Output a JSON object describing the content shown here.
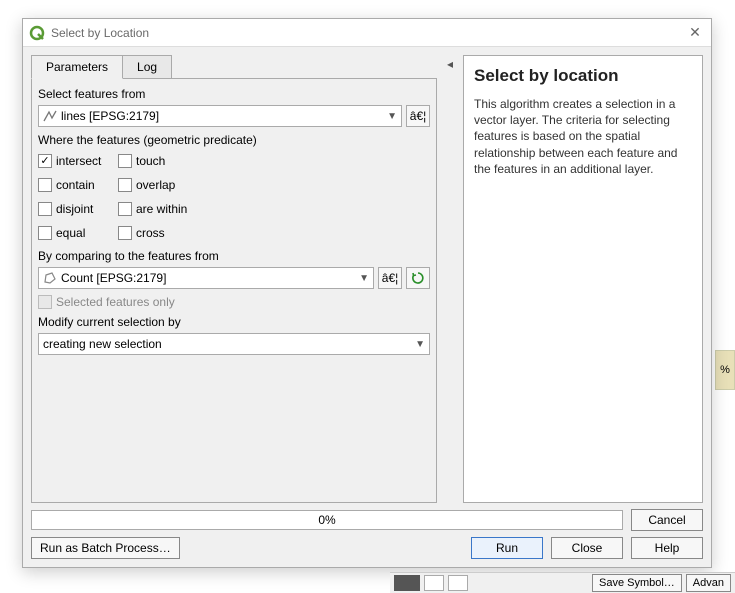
{
  "window": {
    "title": "Select by Location",
    "close_glyph": "✕"
  },
  "tabs": {
    "parameters": "Parameters",
    "log": "Log"
  },
  "form": {
    "select_from_label": "Select features from",
    "select_from_value": "lines [EPSG:2179]",
    "predicate_label": "Where the features (geometric predicate)",
    "predicates": {
      "intersect": "intersect",
      "touch": "touch",
      "contain": "contain",
      "overlap": "overlap",
      "disjoint": "disjoint",
      "are_within": "are within",
      "equal": "equal",
      "cross": "cross"
    },
    "compare_label": "By comparing to the features from",
    "compare_value": "Count [EPSG:2179]",
    "selected_only": "Selected features only",
    "modify_label": "Modify current selection by",
    "modify_value": "creating new selection",
    "ellipsis": "â€¦"
  },
  "help": {
    "title": "Select by location",
    "text": "This algorithm creates a selection in a vector layer. The criteria for selecting features is based on the spatial relationship between each feature and the features in an additional layer."
  },
  "progress": {
    "percent": "0%"
  },
  "buttons": {
    "cancel": "Cancel",
    "run": "Run",
    "close": "Close",
    "help": "Help",
    "batch": "Run as Batch Process…"
  },
  "bg": {
    "save_symbol": "Save Symbol…",
    "advanced": "Advan",
    "right_pct": "%"
  }
}
